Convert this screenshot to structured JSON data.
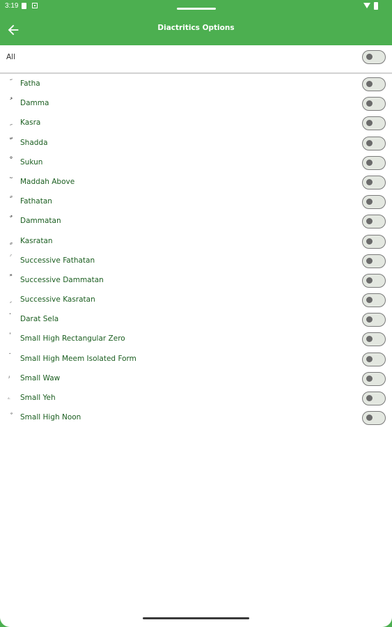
{
  "status_bar": {
    "time": "3:19",
    "icons": [
      "sd-card-icon",
      "notification-box-icon",
      "wifi-icon",
      "battery-icon"
    ]
  },
  "app_bar": {
    "title": "Diactritics Options",
    "back_icon": "arrow-left-icon"
  },
  "all_option": {
    "label": "All",
    "enabled": false
  },
  "options": [
    {
      "glyph": "َ",
      "label": "Fatha",
      "enabled": false
    },
    {
      "glyph": "ُ",
      "label": "Damma",
      "enabled": false
    },
    {
      "glyph": "ِ",
      "label": "Kasra",
      "enabled": false
    },
    {
      "glyph": "ّ",
      "label": "Shadda",
      "enabled": false
    },
    {
      "glyph": "ْ",
      "label": "Sukun",
      "enabled": false
    },
    {
      "glyph": "ٓ",
      "label": "Maddah Above",
      "enabled": false
    },
    {
      "glyph": "ً",
      "label": "Fathatan",
      "enabled": false
    },
    {
      "glyph": "ٌ",
      "label": "Dammatan",
      "enabled": false
    },
    {
      "glyph": "ٍ",
      "label": "Kasratan",
      "enabled": false
    },
    {
      "glyph": "ࣰ",
      "label": "Successive Fathatan",
      "enabled": false
    },
    {
      "glyph": "ࣱ",
      "label": "Successive Dammatan",
      "enabled": false
    },
    {
      "glyph": "ࣲ",
      "label": "Successive Kasratan",
      "enabled": false
    },
    {
      "glyph": "۬",
      "label": "Darat Sela",
      "enabled": false
    },
    {
      "glyph": "۟",
      "label": "Small High Rectangular Zero",
      "enabled": false
    },
    {
      "glyph": "ۘ",
      "label": "Small High Meem Isolated Form",
      "enabled": false
    },
    {
      "glyph": "ۥ",
      "label": "Small Waw",
      "enabled": false
    },
    {
      "glyph": "ۦ",
      "label": "Small Yeh",
      "enabled": false
    },
    {
      "glyph": "ۨ",
      "label": "Small High Noon",
      "enabled": false
    }
  ],
  "colors": {
    "primary": "#4caf50",
    "label_text": "#1b5e20",
    "toggle_track": "#e3e7e0",
    "toggle_thumb": "#6b6b6b"
  }
}
